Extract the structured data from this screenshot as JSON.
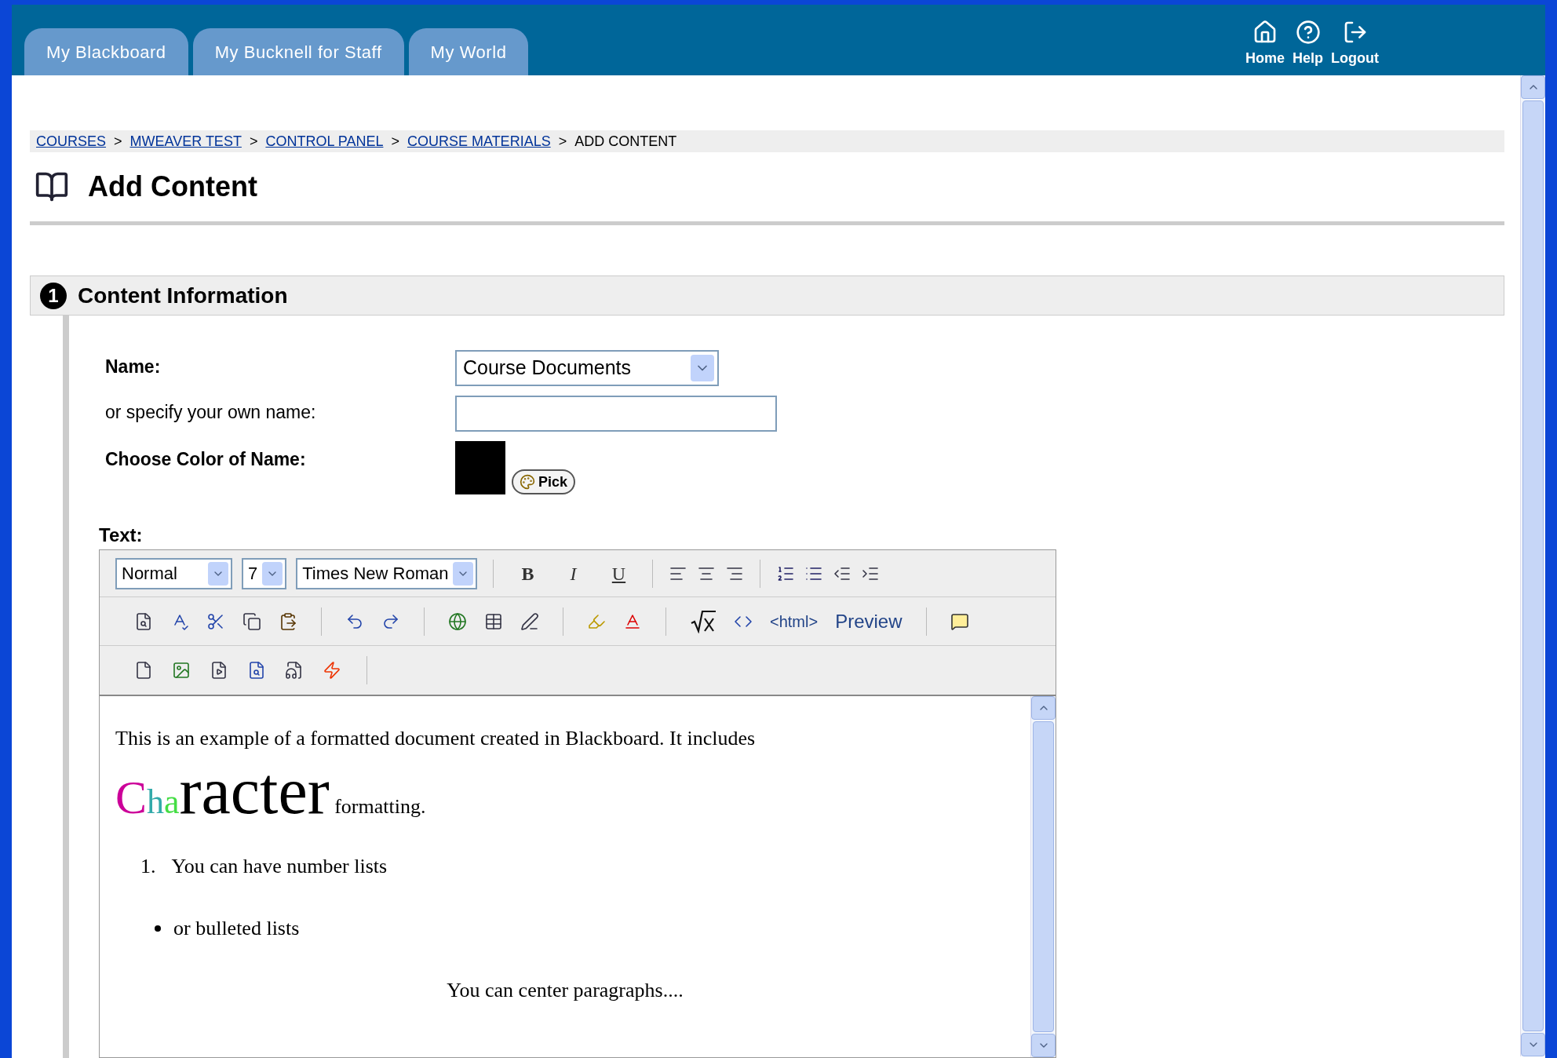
{
  "top_tabs": [
    {
      "label": "My Blackboard"
    },
    {
      "label": "My Bucknell for Staff"
    },
    {
      "label": "My World"
    }
  ],
  "top_links": [
    {
      "label": "Home",
      "kind": "home"
    },
    {
      "label": "Help",
      "kind": "help"
    },
    {
      "label": "Logout",
      "kind": "logout"
    }
  ],
  "breadcrumb": [
    {
      "label": "COURSES",
      "link": true
    },
    {
      "separator": ">",
      "label": "MWEAVER TEST",
      "link": true
    },
    {
      "separator": ">",
      "label": "CONTROL PANEL",
      "link": true
    },
    {
      "separator": ">",
      "label": "COURSE MATERIALS",
      "link": true
    },
    {
      "separator": ">",
      "label": "ADD CONTENT",
      "link": false
    }
  ],
  "page_title": "Add Content",
  "section": {
    "number": "1",
    "title": "Content Information"
  },
  "form": {
    "name_label": "Name:",
    "name_select": "Course Documents",
    "own_name_label": "or specify your own name:",
    "color_label": "Choose Color of Name:",
    "color": "#000000",
    "pick_button": "Pick"
  },
  "editor": {
    "label": "Text:",
    "dropdowns": [
      {
        "value": "Normal"
      },
      {
        "value": "7"
      },
      {
        "value": "Times New Roman"
      }
    ],
    "style_buttons": [
      {
        "label": "B",
        "kind": "bold"
      },
      {
        "label": "I",
        "kind": "italic"
      },
      {
        "label": "U",
        "kind": "underline"
      }
    ],
    "text_buttons": [
      "<html>",
      "Preview"
    ],
    "content": [
      {
        "kind": "paragraph",
        "text": "This is an example of a formatted document created in Blackboard. It includes"
      },
      {
        "kind": "styled",
        "segments": [
          {
            "text": "C",
            "color": "#cc0099",
            "kind": "medium"
          },
          {
            "text": "h",
            "color": "#33aaaa",
            "kind": "small"
          },
          {
            "text": "a",
            "color": "#44dd44",
            "kind": "small"
          },
          {
            "text": "racter",
            "color": "#000000",
            "kind": "huge"
          },
          {
            "text": " formatting.",
            "color": "#000000",
            "kind": "normal"
          }
        ]
      },
      {
        "kind": "numbered",
        "number": "1.",
        "text": "You can have number lists"
      },
      {
        "kind": "bullet",
        "text": "or bulleted lists"
      },
      {
        "kind": "centered",
        "text": "You can center paragraphs...."
      }
    ]
  }
}
